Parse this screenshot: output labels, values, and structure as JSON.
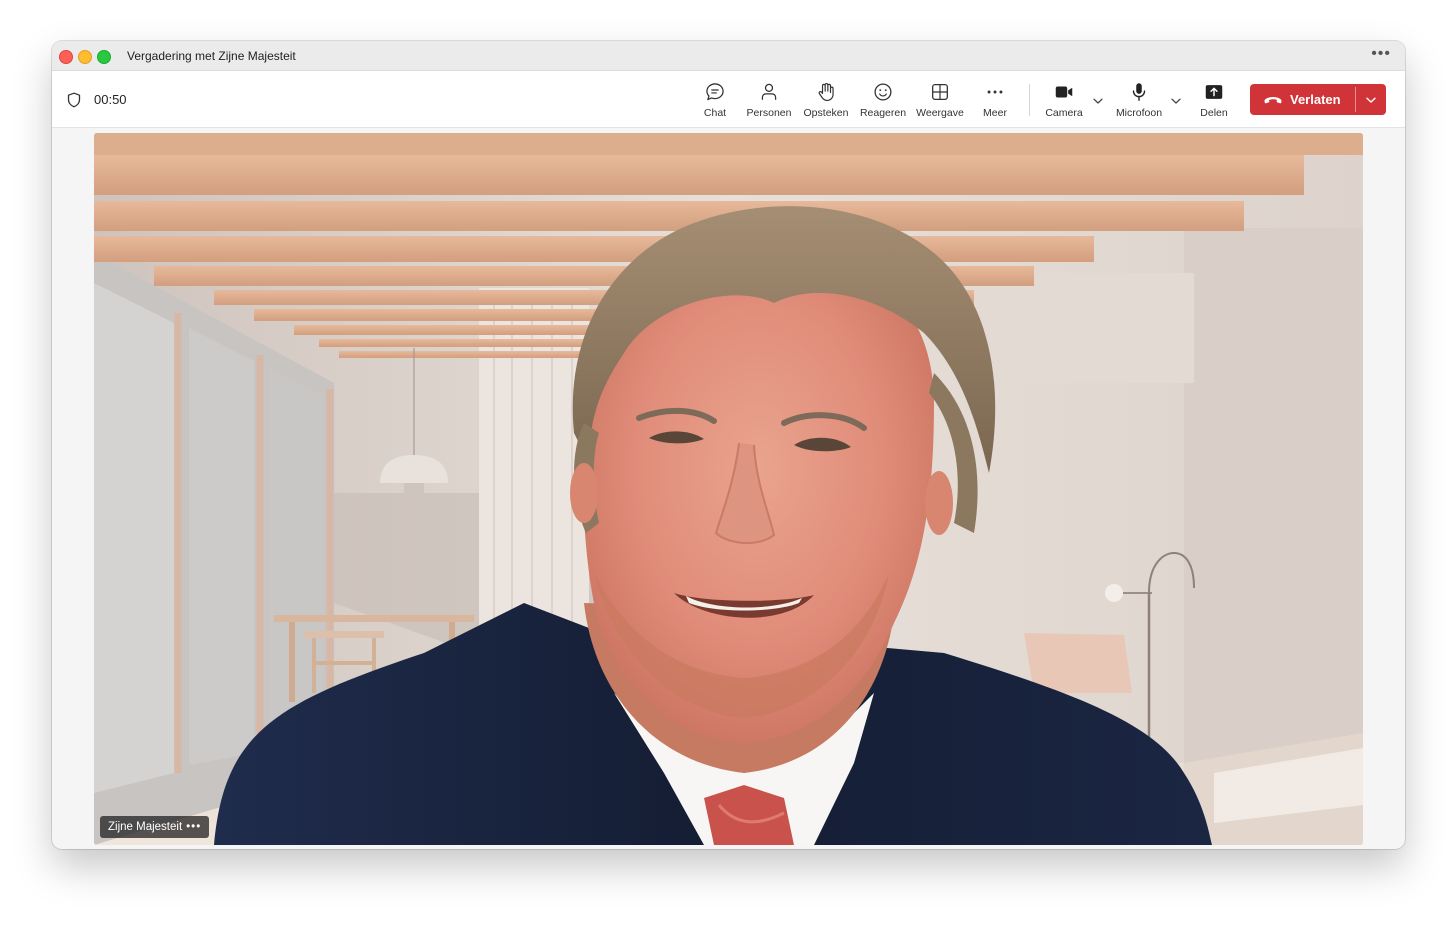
{
  "window": {
    "title": "Vergadering met Zijne Majesteit",
    "more_glyph": "•••"
  },
  "meeting": {
    "timer": "00:50"
  },
  "toolbar": {
    "items": [
      {
        "id": "chat",
        "label": "Chat",
        "icon": "chat-icon"
      },
      {
        "id": "people",
        "label": "Personen",
        "icon": "people-icon"
      },
      {
        "id": "raise",
        "label": "Opsteken",
        "icon": "raise-hand-icon"
      },
      {
        "id": "react",
        "label": "Reageren",
        "icon": "smiley-icon"
      },
      {
        "id": "view",
        "label": "Weergave",
        "icon": "grid-view-icon"
      },
      {
        "id": "more",
        "label": "Meer",
        "icon": "more-icon"
      },
      {
        "id": "camera",
        "label": "Camera",
        "icon": "camera-icon"
      },
      {
        "id": "mic",
        "label": "Microfoon",
        "icon": "microphone-icon"
      },
      {
        "id": "share",
        "label": "Delen",
        "icon": "share-icon"
      }
    ],
    "leave_label": "Verlaten"
  },
  "participant": {
    "name": "Zijne Majesteit",
    "more_glyph": "•••"
  },
  "colors": {
    "leave": "#d13438",
    "toolbar_bg": "#ffffff",
    "titlebar_bg": "#ebebeb"
  }
}
